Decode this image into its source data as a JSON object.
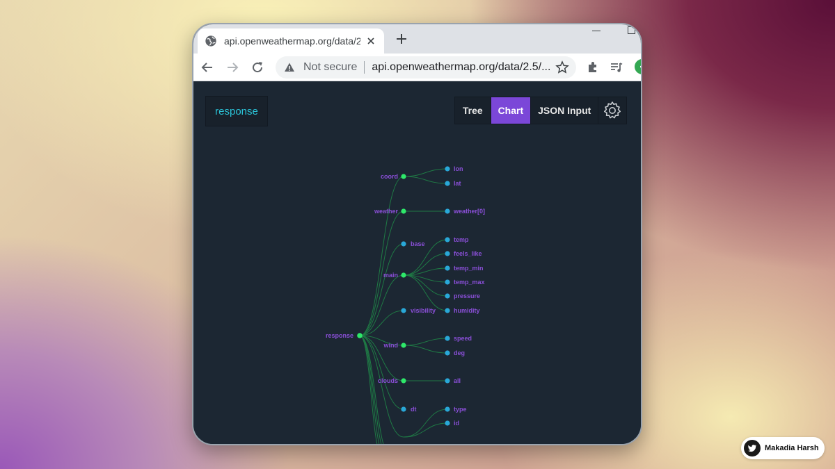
{
  "browser": {
    "tab_title": "api.openweathermap.org/data/2.5/",
    "security_label": "Not secure",
    "url": "api.openweathermap.org/data/2.5/...",
    "profile_initial": "<"
  },
  "app": {
    "response_label": "response",
    "views": [
      {
        "label": "Tree",
        "active": false
      },
      {
        "label": "Chart",
        "active": true
      },
      {
        "label": "JSON Input",
        "active": false
      }
    ],
    "settings_icon": "gear-icon",
    "accent_color": "#7b47d8"
  },
  "tree": {
    "root": "response",
    "groups": [
      {
        "label": "coord",
        "children": [
          "lon",
          "lat"
        ]
      },
      {
        "label": "weather",
        "children": [
          "weather[0]"
        ]
      },
      {
        "label": "base",
        "children": []
      },
      {
        "label": "main",
        "children": [
          "temp",
          "feels_like",
          "temp_min",
          "temp_max",
          "pressure",
          "humidity"
        ]
      },
      {
        "label": "visibility",
        "children": []
      },
      {
        "label": "wind",
        "children": [
          "speed",
          "deg"
        ]
      },
      {
        "label": "clouds",
        "children": [
          "all"
        ]
      },
      {
        "label": "dt",
        "children": []
      },
      {
        "label": "",
        "children": [
          "type",
          "id"
        ]
      }
    ],
    "colors": {
      "branch_node": "#2ee86a",
      "leaf_node": "#29a8d8",
      "label": "#8a4fd8",
      "link": "#1f7a45"
    }
  },
  "attribution": {
    "name": "Makadia Harsh",
    "icon": "twitter-bird-icon"
  }
}
